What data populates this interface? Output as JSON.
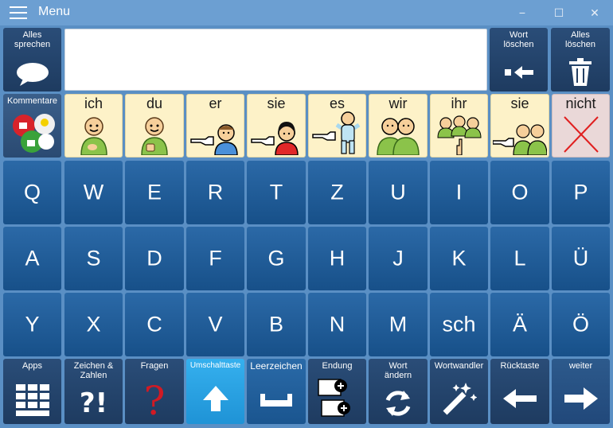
{
  "titlebar": {
    "title": "Menu",
    "minimize_glyph": "−",
    "maximize_glyph": "☐",
    "close_glyph": "✕"
  },
  "top_row": {
    "speak_all": "Alles sprechen",
    "delete_word": "Wort löschen",
    "delete_all": "Alles löschen",
    "text_value": ""
  },
  "comments_label": "Kommentare",
  "words": [
    "ich",
    "du",
    "er",
    "sie",
    "es",
    "wir",
    "ihr",
    "sie",
    "nicht"
  ],
  "letters": {
    "row1": [
      "Q",
      "W",
      "E",
      "R",
      "T",
      "Z",
      "U",
      "I",
      "O",
      "P"
    ],
    "row2": [
      "A",
      "S",
      "D",
      "F",
      "G",
      "H",
      "J",
      "K",
      "L",
      "Ü"
    ],
    "row3": [
      "Y",
      "X",
      "C",
      "V",
      "B",
      "N",
      "M",
      "sch",
      "Ä",
      "Ö"
    ]
  },
  "bottom_row": {
    "apps": "Apps",
    "symbols": "Zeichen & Zahlen",
    "symbols_glyph": "?!",
    "questions": "Fragen",
    "questions_glyph": "?",
    "shift": "Umschalttaste",
    "space": "Leerzeichen",
    "ending": "Endung",
    "change_word": "Wort ändern",
    "word_changer": "Wortwandler",
    "backspace": "Rücktaste",
    "next": "weiter"
  },
  "colors": {
    "background": "#5a8fc4",
    "letter_key": "#1f5c98",
    "function_key": "#243f63",
    "word_key": "#fdf2c8",
    "shift_active": "#29a3e6"
  }
}
